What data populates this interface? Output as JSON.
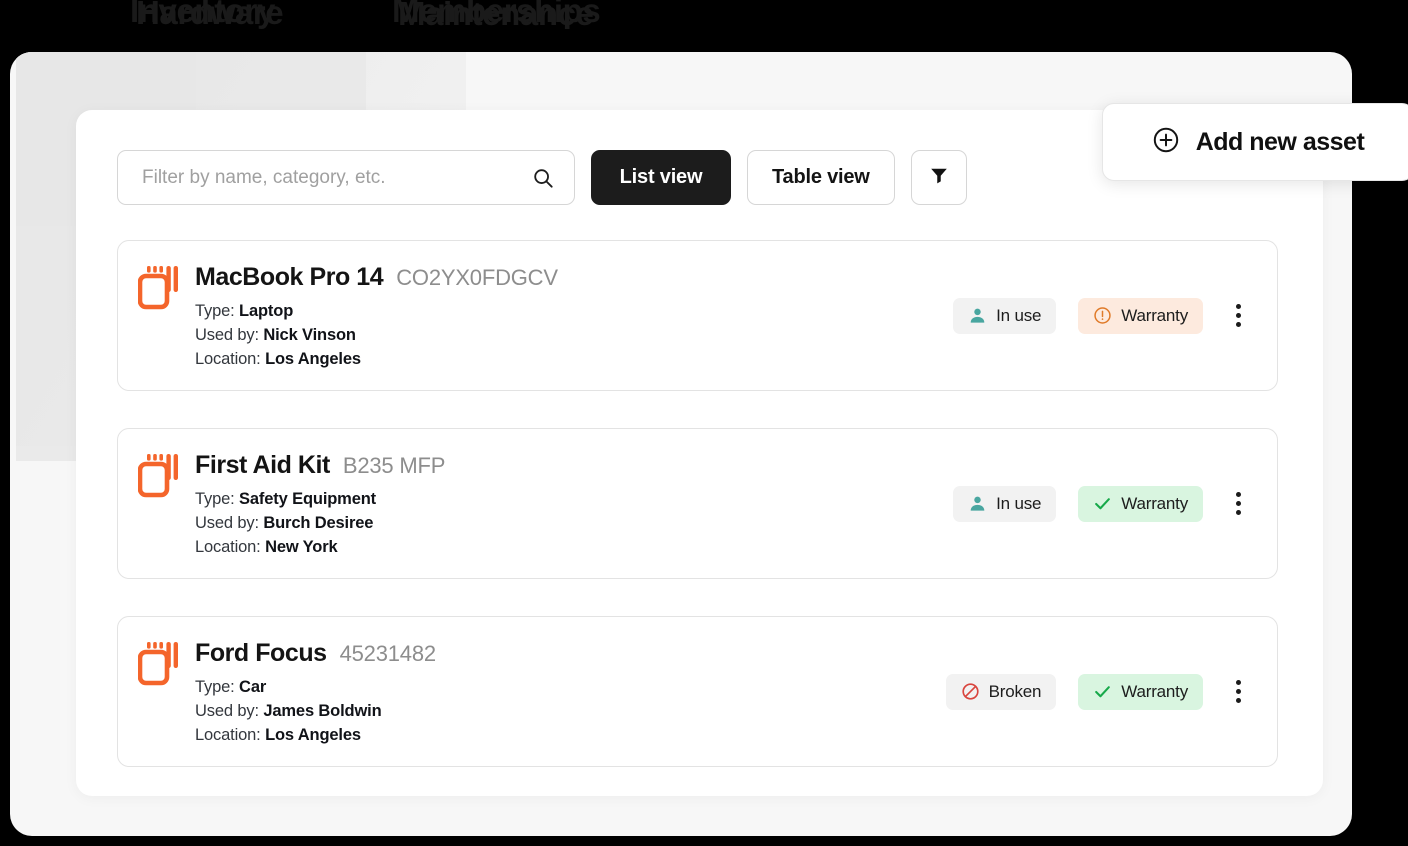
{
  "top_headings": {
    "heading_left_a": "Inventory",
    "heading_left_b": "Hardware",
    "heading_right_a": "Memberships",
    "heading_right_b": "Maintenance"
  },
  "toolbar": {
    "search_placeholder": "Filter by name, category, etc.",
    "search_value": "",
    "search_icon": "search-icon",
    "list_view_label": "List view",
    "table_view_label": "Table view",
    "filter_icon": "funnel-icon"
  },
  "add_button": {
    "label": "Add new asset",
    "icon": "plus-circle-icon"
  },
  "colors": {
    "accent_orange": "#F4652B",
    "dark": "#1C1C1C",
    "badge_gray_bg": "#F2F2F2",
    "badge_green_bg": "#D9F5E0",
    "badge_peach_bg": "#FDEADE",
    "in_use_icon": "#49A6A0",
    "warranty_ok_icon": "#17A94A",
    "warranty_warn_icon": "#E07A28",
    "broken_icon": "#D9453E",
    "panel_bg": "#F7F7F7",
    "card_bg": "#FFFFFF"
  },
  "labels": {
    "type": "Type:",
    "used_by": "Used by:",
    "location": "Location:"
  },
  "assets": [
    {
      "name": "MacBook Pro 14",
      "serial": "CO2YX0FDGCV",
      "type": "Laptop",
      "used_by": "Nick Vinson",
      "location": "Los Angeles",
      "status_label": "In use",
      "status_icon": "person-icon",
      "status_style": "gray",
      "warranty_label": "Warranty",
      "warranty_icon": "alert-circle-icon",
      "warranty_style": "peach"
    },
    {
      "name": "First Aid Kit",
      "serial": "B235 MFP",
      "type": "Safety Equipment",
      "used_by": "Burch Desiree",
      "location": "New York",
      "status_label": "In use",
      "status_icon": "person-icon",
      "status_style": "gray",
      "warranty_label": "Warranty",
      "warranty_icon": "check-icon",
      "warranty_style": "green"
    },
    {
      "name": "Ford Focus",
      "serial": "45231482",
      "type": "Car",
      "used_by": "James Boldwin",
      "location": "Los Angeles",
      "status_label": "Broken",
      "status_icon": "prohibited-icon",
      "status_style": "gray",
      "warranty_label": "Warranty",
      "warranty_icon": "check-icon",
      "warranty_style": "green"
    }
  ]
}
